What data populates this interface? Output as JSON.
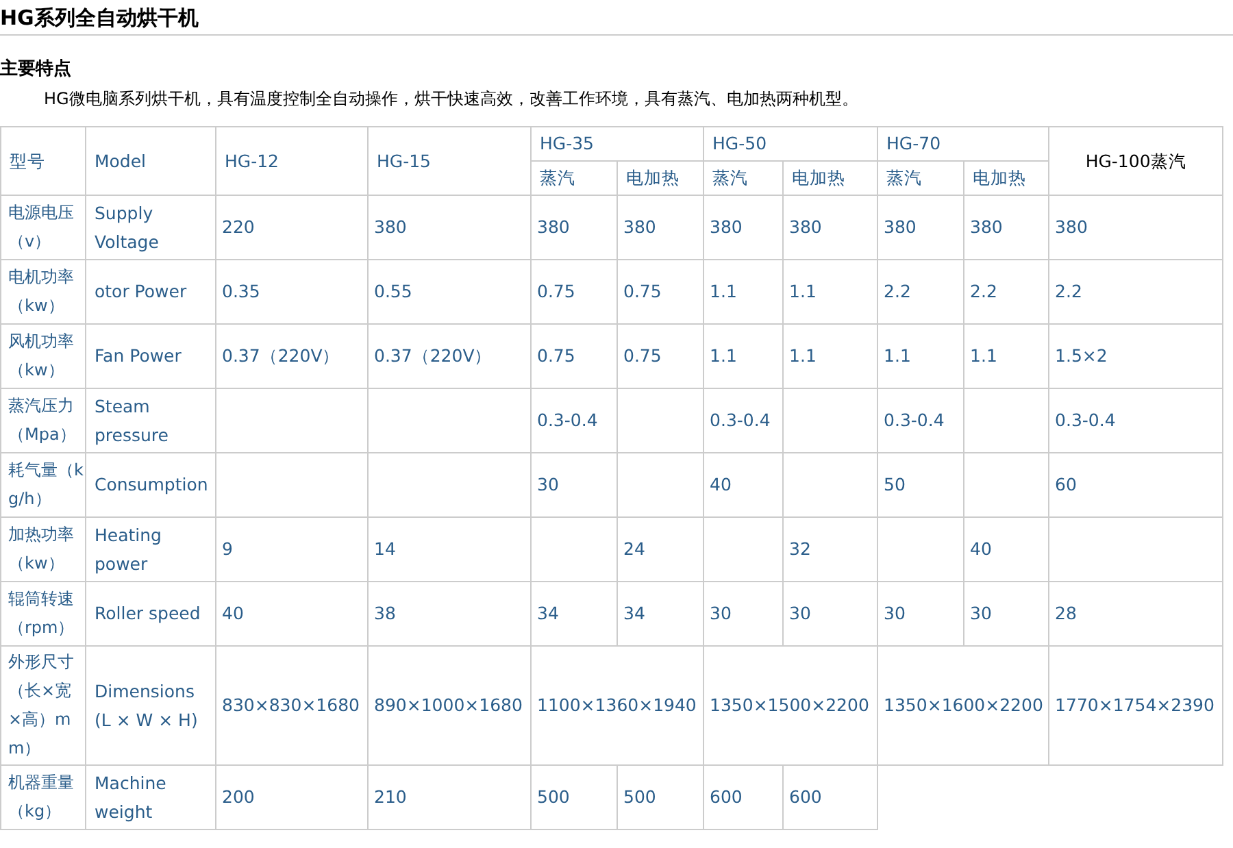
{
  "title": "HG系列全自动烘干机",
  "section": "主要特点",
  "intro": "HG微电脑系列烘干机，具有温度控制全自动操作，烘干快速高效，改善工作环境，具有蒸汽、电加热两种机型。",
  "table": {
    "columns": [
      {
        "label": "型号",
        "kind": "single"
      },
      {
        "label": "Model",
        "kind": "single"
      },
      {
        "label": "HG-12",
        "kind": "single"
      },
      {
        "label": "HG-15",
        "kind": "single"
      },
      {
        "label": "HG-35",
        "kind": "group",
        "colspan": 2,
        "subcolumns": [
          "蒸汽",
          "电加热"
        ]
      },
      {
        "label": "HG-50",
        "kind": "group",
        "colspan": 2,
        "subcolumns": [
          "蒸汽",
          "电加热"
        ]
      },
      {
        "label": "HG-70",
        "kind": "group",
        "colspan": 2,
        "subcolumns": [
          "蒸汽",
          "电加热"
        ]
      },
      {
        "label": "HG-100蒸汽",
        "kind": "centered"
      }
    ],
    "rows": [
      {
        "cells": [
          {
            "kind": "label",
            "text": "电源电压（v）"
          },
          {
            "kind": "label",
            "text": "Supply\nVoltage"
          },
          {
            "kind": "value",
            "text": "220"
          },
          {
            "kind": "value",
            "text": "380"
          },
          {
            "kind": "value",
            "text": "380"
          },
          {
            "kind": "value",
            "text": "380"
          },
          {
            "kind": "value",
            "text": "380"
          },
          {
            "kind": "value",
            "text": "380"
          },
          {
            "kind": "value",
            "text": "380"
          },
          {
            "kind": "value",
            "text": "380"
          },
          {
            "kind": "value",
            "text": "380"
          }
        ]
      },
      {
        "cells": [
          {
            "kind": "label",
            "text": "电机功率（kw）"
          },
          {
            "kind": "label",
            "text": "otor Power"
          },
          {
            "kind": "value",
            "text": "0.35"
          },
          {
            "kind": "value",
            "text": "0.55"
          },
          {
            "kind": "value",
            "text": "0.75"
          },
          {
            "kind": "value",
            "text": "0.75"
          },
          {
            "kind": "value",
            "text": "1.1"
          },
          {
            "kind": "value",
            "text": "1.1"
          },
          {
            "kind": "value",
            "text": "2.2"
          },
          {
            "kind": "value",
            "text": "2.2"
          },
          {
            "kind": "value",
            "text": "2.2"
          }
        ]
      },
      {
        "cells": [
          {
            "kind": "label",
            "text": "风机功率（kw）"
          },
          {
            "kind": "label",
            "text": "Fan Power"
          },
          {
            "kind": "value",
            "text": "0.37（220V）"
          },
          {
            "kind": "value",
            "text": "0.37（220V）"
          },
          {
            "kind": "value",
            "text": "0.75"
          },
          {
            "kind": "value",
            "text": "0.75"
          },
          {
            "kind": "value",
            "text": "1.1"
          },
          {
            "kind": "value",
            "text": "1.1"
          },
          {
            "kind": "value",
            "text": "1.1"
          },
          {
            "kind": "value",
            "text": "1.1"
          },
          {
            "kind": "value",
            "text": "1.5×2"
          }
        ]
      },
      {
        "cells": [
          {
            "kind": "label",
            "text": "蒸汽压力（Mpa）"
          },
          {
            "kind": "label",
            "text": "Steam\npressure"
          },
          {
            "kind": "blank"
          },
          {
            "kind": "blank"
          },
          {
            "kind": "value",
            "text": "0.3-0.4"
          },
          {
            "kind": "blank"
          },
          {
            "kind": "value",
            "text": "0.3-0.4"
          },
          {
            "kind": "blank"
          },
          {
            "kind": "value",
            "text": "0.3-0.4"
          },
          {
            "kind": "blank"
          },
          {
            "kind": "value",
            "text": "0.3-0.4"
          }
        ]
      },
      {
        "cells": [
          {
            "kind": "label",
            "text": "耗气量（kg/h）"
          },
          {
            "kind": "label",
            "text": "Consumption"
          },
          {
            "kind": "blank"
          },
          {
            "kind": "blank"
          },
          {
            "kind": "value",
            "text": "30"
          },
          {
            "kind": "blank"
          },
          {
            "kind": "value",
            "text": "40"
          },
          {
            "kind": "blank"
          },
          {
            "kind": "value",
            "text": "50"
          },
          {
            "kind": "blank"
          },
          {
            "kind": "value",
            "text": "60"
          }
        ]
      },
      {
        "cells": [
          {
            "kind": "label",
            "text": "加热功率（kw）"
          },
          {
            "kind": "label",
            "text": "Heating\npower"
          },
          {
            "kind": "value",
            "text": "9"
          },
          {
            "kind": "value",
            "text": "14"
          },
          {
            "kind": "blank"
          },
          {
            "kind": "value",
            "text": "24"
          },
          {
            "kind": "blank"
          },
          {
            "kind": "value",
            "text": "32"
          },
          {
            "kind": "blank"
          },
          {
            "kind": "value",
            "text": "40"
          },
          {
            "kind": "blank"
          }
        ]
      },
      {
        "cells": [
          {
            "kind": "label",
            "text": "辊筒转速（rpm）"
          },
          {
            "kind": "label",
            "text": "Roller speed"
          },
          {
            "kind": "value",
            "text": "40"
          },
          {
            "kind": "value",
            "text": "38"
          },
          {
            "kind": "value",
            "text": "34"
          },
          {
            "kind": "value",
            "text": "34"
          },
          {
            "kind": "value",
            "text": "30"
          },
          {
            "kind": "value",
            "text": "30"
          },
          {
            "kind": "value",
            "text": "30"
          },
          {
            "kind": "value",
            "text": "30"
          },
          {
            "kind": "value",
            "text": "28"
          }
        ]
      },
      {
        "cells": [
          {
            "kind": "label",
            "text": "外形尺寸（长×宽×高）mm）"
          },
          {
            "kind": "label",
            "text": "Dimensions\n(L × W × H)"
          },
          {
            "kind": "value",
            "text": "830×830×1680"
          },
          {
            "kind": "value",
            "text": "890×1000×1680"
          },
          {
            "kind": "wide",
            "colspan": 2,
            "text": "1100×1360×1940"
          },
          {
            "kind": "wide",
            "colspan": 2,
            "text": "1350×1500×2200"
          },
          {
            "kind": "wide",
            "colspan": 2,
            "text": "1350×1600×2200"
          },
          {
            "kind": "value",
            "text": "1770×1754×2390"
          }
        ]
      },
      {
        "cells": [
          {
            "kind": "label",
            "text": "机器重量（kg）"
          },
          {
            "kind": "label",
            "text": "Machine\nweight"
          },
          {
            "kind": "value",
            "text": "200"
          },
          {
            "kind": "value",
            "text": "210"
          },
          {
            "kind": "value",
            "text": "500"
          },
          {
            "kind": "value",
            "text": "500"
          },
          {
            "kind": "value",
            "text": "600"
          },
          {
            "kind": "value",
            "text": "600"
          }
        ]
      }
    ]
  }
}
